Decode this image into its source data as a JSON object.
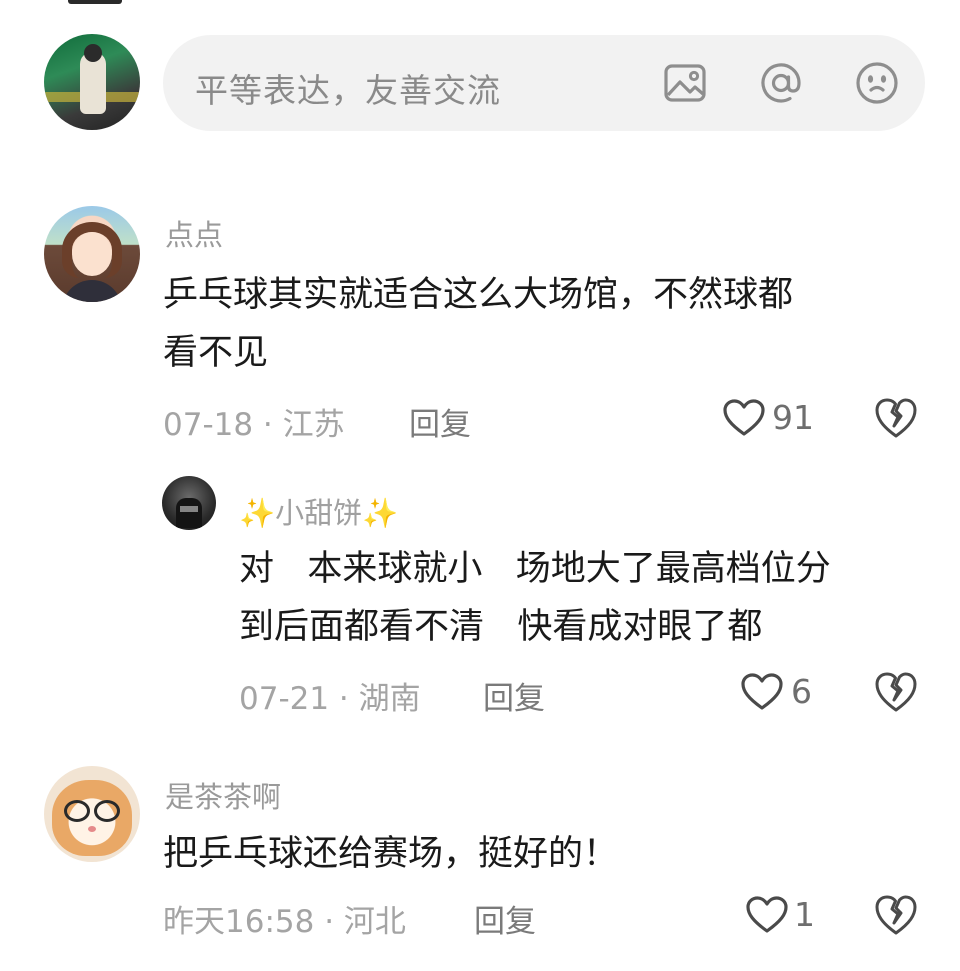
{
  "compose": {
    "placeholder": "平等表达，友善交流",
    "icons": [
      "image-icon",
      "at-icon",
      "emoji-icon"
    ]
  },
  "comments": [
    {
      "user": "点点",
      "text": "乒乓球其实就适合这么大场馆，不然球都\n看不见",
      "date": "07-18",
      "location": "江苏",
      "meta": "07-18 · 江苏",
      "reply_label": "回复",
      "likes": "91",
      "replies": [
        {
          "user": "✨小甜饼✨",
          "text": "对   本来球就小   场地大了最高档位分\n到后面都看不清   快看成对眼了都",
          "date": "07-21",
          "location": "湖南",
          "meta": "07-21 · 湖南",
          "reply_label": "回复",
          "likes": "6"
        }
      ]
    },
    {
      "user": "是茶茶啊",
      "text": "把乒乓球还给赛场，挺好的！",
      "date": "昨天16:58",
      "location": "河北",
      "meta": "昨天16:58 · 河北",
      "reply_label": "回复",
      "likes": "1"
    }
  ],
  "colors": {
    "input_bg": "#f2f2f2",
    "meta_text": "#a4a4a4",
    "name_text": "#9a9a9a",
    "body_text": "#1a1a1a"
  }
}
